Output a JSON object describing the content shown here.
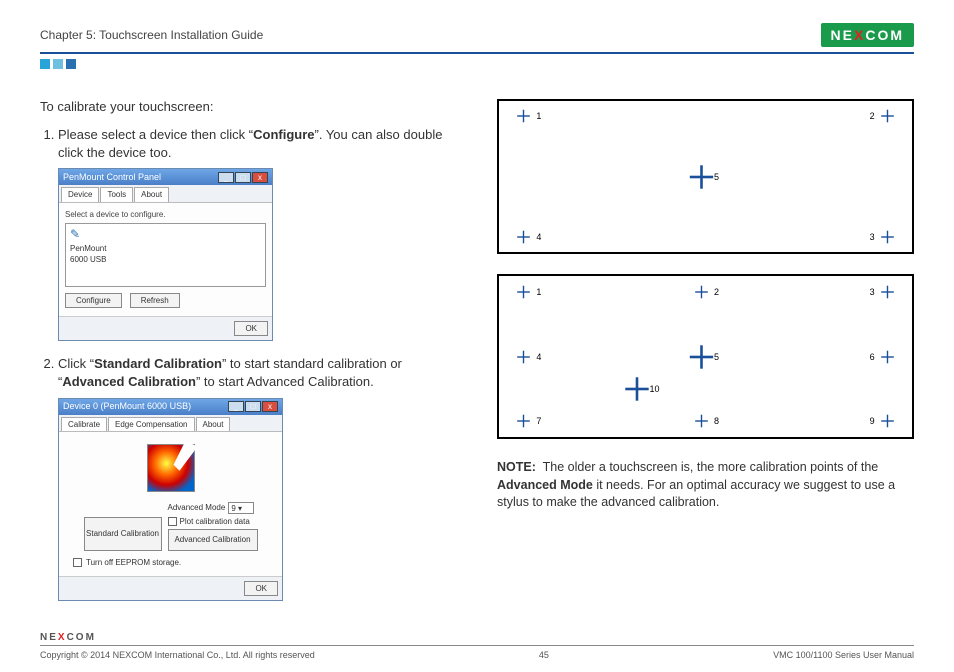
{
  "header": {
    "chapter": "Chapter 5: Touchscreen Installation Guide",
    "brand": "NEXCOM"
  },
  "intro": "To calibrate your touchscreen:",
  "step1": {
    "pre": "Please select a device then click “",
    "bold": "Configure",
    "post": "”. You can also double click the device too."
  },
  "dlg1": {
    "title": "PenMount Control Panel",
    "tabs": [
      "Device",
      "Tools",
      "About"
    ],
    "hint": "Select a device to configure.",
    "item1": "PenMount",
    "item2": "6000 USB",
    "btn_configure": "Configure",
    "btn_refresh": "Refresh",
    "ok": "OK"
  },
  "step2": {
    "pre": "Click “",
    "b1": "Standard Calibration",
    "mid": "” to start standard calibration or “",
    "b2": "Advanced Calibration",
    "post": "” to start Advanced Calibration."
  },
  "dlg2": {
    "title": "Device 0 (PenMount 6000 USB)",
    "tabs": [
      "Calibrate",
      "Edge Compensation",
      "About"
    ],
    "std": "Standard Calibration",
    "advmode_label": "Advanced Mode",
    "advmode_value": "9",
    "plot": "Plot calibration data",
    "adv": "Advanced Calibration",
    "turnoff": "Turn off EEPROM storage.",
    "ok": "OK"
  },
  "grid5": {
    "p1": "1",
    "p2": "2",
    "p3": "3",
    "p4": "4",
    "p5": "5"
  },
  "grid10": {
    "p1": "1",
    "p2": "2",
    "p3": "3",
    "p4": "4",
    "p5": "5",
    "p6": "6",
    "p7": "7",
    "p8": "8",
    "p9": "9",
    "p10": "10"
  },
  "note": {
    "label": "NOTE:",
    "t1": "The older a touchscreen is, the more calibration points of the ",
    "b": "Advanced Mode",
    "t2": " it needs. For an optimal accuracy we suggest to use a stylus to make the advanced calibration."
  },
  "footer": {
    "brand": "NEXCOM",
    "copyright": "Copyright © 2014 NEXCOM International Co., Ltd. All rights reserved",
    "page": "45",
    "doc": "VMC 100/1100 Series User Manual"
  }
}
